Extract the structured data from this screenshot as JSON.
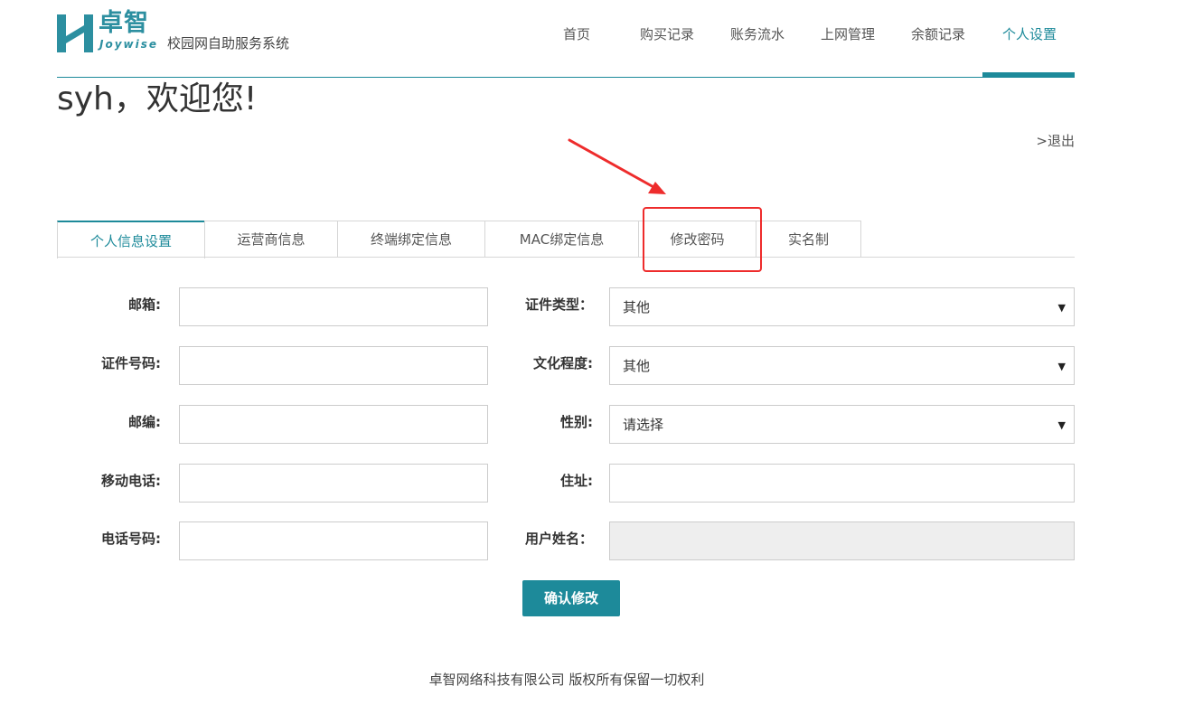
{
  "brand": {
    "name_cn": "卓智",
    "name_en": "Joywise",
    "subtitle": "校园网自助服务系统",
    "color": "#2c8fa0"
  },
  "nav": {
    "items": [
      {
        "label": "首页"
      },
      {
        "label": "购买记录"
      },
      {
        "label": "账务流水"
      },
      {
        "label": "上网管理"
      },
      {
        "label": "余额记录"
      },
      {
        "label": "个人设置"
      }
    ],
    "active": "个人设置"
  },
  "welcome": "syh，欢迎您!",
  "logout_label": ">退出",
  "tabs": [
    {
      "label": "个人信息设置",
      "active": true
    },
    {
      "label": "运营商信息"
    },
    {
      "label": "终端绑定信息"
    },
    {
      "label": "MAC绑定信息"
    },
    {
      "label": "修改密码",
      "highlighted": true
    },
    {
      "label": "实名制"
    }
  ],
  "form": {
    "email": {
      "label": "邮箱:",
      "value": ""
    },
    "id_number": {
      "label": "证件号码:",
      "value": ""
    },
    "postcode": {
      "label": "邮编:",
      "value": ""
    },
    "mobile": {
      "label": "移动电话:",
      "value": ""
    },
    "phone": {
      "label": "电话号码:",
      "value": ""
    },
    "id_type": {
      "label": "证件类型：",
      "value": "其他"
    },
    "education": {
      "label": "文化程度:",
      "value": "其他"
    },
    "gender": {
      "label": "性别:",
      "value": "请选择"
    },
    "address": {
      "label": "住址:",
      "value": ""
    },
    "username": {
      "label": "用户姓名：",
      "value": "",
      "disabled": true
    },
    "submit_label": "确认修改"
  },
  "footer": "卓智网络科技有限公司 版权所有保留一切权利",
  "colors": {
    "accent": "#1d8a9a",
    "annotation": "#ee2c2c"
  },
  "icons": {
    "logo": "joywise-logo-icon",
    "caret": "caret-down-icon",
    "annotation_arrow": "red-arrow-icon"
  }
}
